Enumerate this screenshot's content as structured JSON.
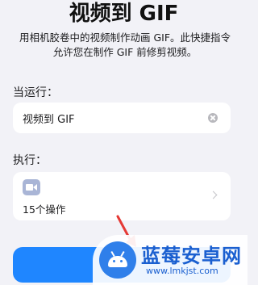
{
  "header": {
    "title": "视频到 GIF",
    "description": "用相机胶卷中的视频制作动画 GIF。此快捷指令允许您在制作 GIF 前修剪视频。"
  },
  "name_section": {
    "label": "当运行：",
    "field_value": "视频到 GIF",
    "clear_icon": "xmark-circle-icon"
  },
  "action_section": {
    "label": "执行：",
    "icon": "video-camera-icon",
    "count_text": "15个操作",
    "chevron": "chevron-right-icon"
  },
  "primary_button": {
    "label": "",
    "color": "#1f86ff"
  },
  "annotation": {
    "arrow_color": "#e53935"
  },
  "watermark": {
    "name": "蓝莓安卓网",
    "url": "www.lmkjst.com",
    "logo": "android-robot-icon"
  },
  "colors": {
    "background": "#f2f2f7",
    "accent": "#1f86ff",
    "icon_bg": "#a9b5d6"
  }
}
